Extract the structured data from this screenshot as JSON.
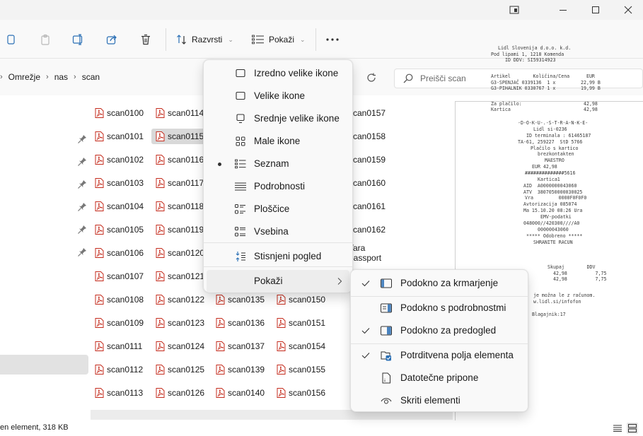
{
  "breadcrumb": [
    "Omrežje",
    "nas",
    "scan"
  ],
  "toolbar": {
    "sort_label": "Razvrsti",
    "view_label": "Pokaži"
  },
  "search": {
    "placeholder": "Preišči scan"
  },
  "files": {
    "col1": [
      "scan0100",
      "scan0101",
      "scan0102",
      "scan0103",
      "scan0104",
      "scan0105",
      "scan0106",
      "scan0107",
      "scan0108",
      "scan0109",
      "scan0111",
      "scan0112",
      "scan0113"
    ],
    "col2": [
      "scan0114",
      "scan0115",
      "scan0116",
      "scan0117",
      "scan0118",
      "scan0119",
      "scan0120",
      "scan0121",
      "scan0122",
      "scan0123",
      "scan0124",
      "scan0125",
      "scan0126"
    ],
    "col3": [
      "scan0135",
      "scan0136",
      "scan0137",
      "scan0139",
      "scan0140"
    ],
    "col4": [
      "scan0150",
      "scan0151",
      "scan0154",
      "scan0155",
      "scan0156"
    ],
    "col5": [
      "scan0157",
      "scan0158",
      "scan0159",
      "scan0160",
      "scan0161",
      "scan0162",
      "Tara passport"
    ],
    "selected": "scan0115"
  },
  "view_menu": {
    "items": [
      {
        "label": "Izredno velike ikone",
        "icon": "monitor-icon"
      },
      {
        "label": "Velike ikone",
        "icon": "monitor-icon"
      },
      {
        "label": "Srednje velike ikone",
        "icon": "monitor-icon"
      },
      {
        "label": "Male ikone",
        "icon": "small-icons-icon"
      },
      {
        "label": "Seznam",
        "icon": "list-icon"
      },
      {
        "label": "Podrobnosti",
        "icon": "details-icon"
      },
      {
        "label": "Ploščice",
        "icon": "tiles-icon"
      },
      {
        "label": "Vsebina",
        "icon": "content-icon"
      },
      {
        "label": "Stisnjeni pogled",
        "icon": "compact-icon"
      },
      {
        "label": "Pokaži",
        "icon": "chevron-right-icon"
      }
    ],
    "active": "Seznam"
  },
  "show_menu": {
    "items": [
      {
        "label": "Podokno za krmarjenje",
        "checked": true
      },
      {
        "label": "Podokno s podrobnostmi",
        "checked": false
      },
      {
        "label": "Podokno za predogled",
        "checked": true
      },
      {
        "label": "Potrditvena polja elementa",
        "checked": true
      },
      {
        "label": "Datotečne pripone",
        "checked": false
      },
      {
        "label": "Skriti elementi",
        "checked": false
      }
    ]
  },
  "receipt": {
    "lines": [
      "Lidl Slovenija d.o.o. k.d.",
      "Pod lipami 1, 1218 Komenda",
      "ID DDV: SI59314923",
      "Artikel        Količina/Cena      EUR",
      "G3-SPENJAČ 0339136  1 x         22,99 B",
      "G3-PIHALNIK 0330767 1 x         19,99 B",
      "Za plačilo:                      42,98",
      "Kartica                          42,98",
      "-D-O-K-U-.-S-T-R-A-N-K-E-",
      "Lidl si-0236",
      "ID terminala : 61465187",
      "TA-61, 259227  StD 5766",
      "Plačilo s kartico",
      "brezkontakten",
      "MAESTRO",
      "EUR 42,98",
      "##############5616",
      "Kartica1",
      "AID  A0000000043060",
      "ATV  3807050000030025",
      "Vra         0000F0F0F0",
      "Avtorizacija 085074",
      "Ma 15.10.20 08:26 Ura",
      "EMV-podatki",
      "048000//420300////A0",
      "00000043060",
      "***** Odobreno *****",
      "SHRANITE RACUN",
      "Skupaj        DDV",
      "42,98          7,75",
      "42,98          7,75",
      "je možna le z računom.",
      "w.lidl.si/infofon",
      "Blagajnik:17"
    ]
  },
  "status": {
    "text": "en element, 318 KB"
  }
}
